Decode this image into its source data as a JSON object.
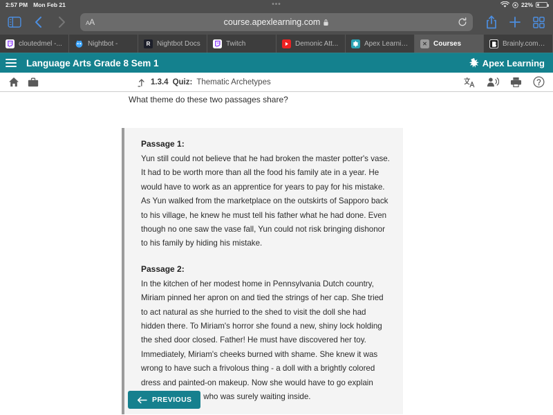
{
  "status_bar": {
    "time": "2:57 PM",
    "date": "Mon Feb 21",
    "battery_percent": "22%",
    "wifi_icon": "wifi-icon",
    "battery_icon": "battery-icon"
  },
  "browser": {
    "sidebar_icon": "sidebar-icon",
    "back_icon": "chevron-left-icon",
    "forward_icon": "chevron-right-icon",
    "text_size_label": "AA",
    "url": "course.apexlearning.com",
    "lock_icon": "lock-icon",
    "reload_icon": "reload-icon",
    "share_icon": "share-icon",
    "new_tab_icon": "plus-icon",
    "tabs_overview_icon": "grid-icon",
    "tabs": [
      {
        "label": "cloutedmel -...",
        "favicon": "twitch-icon",
        "active": false
      },
      {
        "label": "Nightbot -",
        "favicon": "nightbot-icon",
        "active": false
      },
      {
        "label": "Nightbot Docs",
        "favicon": "readme-icon",
        "active": false
      },
      {
        "label": "Twitch",
        "favicon": "twitch-icon",
        "active": false
      },
      {
        "label": "Demonic Att...",
        "favicon": "youtube-icon",
        "active": false
      },
      {
        "label": "Apex Learning",
        "favicon": "apex-icon",
        "active": false
      },
      {
        "label": "Courses",
        "favicon": "blank-icon",
        "active": true
      },
      {
        "label": "Brainly.com -...",
        "favicon": "brainly-icon",
        "active": false
      }
    ]
  },
  "app_header": {
    "menu_icon": "list-menu-icon",
    "course_title": "Language Arts Grade 8 Sem 1",
    "brand_name": "Apex Learning",
    "brand_icon": "apex-logo-icon",
    "background_color": "#14818e"
  },
  "breadcrumb": {
    "home_icon": "home-icon",
    "briefcase_icon": "briefcase-icon",
    "up_icon": "arrow-up-icon",
    "lesson_number": "1.3.4",
    "activity_type": "Quiz:",
    "activity_title": "Thematic Archetypes",
    "translate_icon": "translate-icon",
    "read_aloud_icon": "read-aloud-icon",
    "print_icon": "print-icon",
    "help_icon": "help-icon"
  },
  "main": {
    "question": "What theme do these two passages share?",
    "passages": [
      {
        "title": "Passage 1:",
        "text": "Yun still could not believe that he had broken the master potter's vase. It had to be worth more than all the food his family ate in a year. He would have to work as an apprentice for years to pay for his mistake. As Yun walked from the marketplace on the outskirts of Sapporo back to his village, he knew he must tell his father what he had done. Even though no one saw the vase fall, Yun could not risk bringing dishonor to his family by hiding his mistake."
      },
      {
        "title": "Passage 2:",
        "text": "In the kitchen of her modest home in Pennsylvania Dutch country, Miriam pinned her apron on and tied the strings of her cap. She tried to act natural as she hurried to the shed to visit the doll she had hidden there. To Miriam's horror she found a new, shiny lock holding the shed door closed. Father! He must have discovered her toy. Immediately, Miriam's cheeks burned with shame. She knew it was wrong to have such a frivolous thing - a doll with a brightly colored dress and painted-on makeup. Now she would have to go explain herself to Father, who was surely waiting inside."
      }
    ],
    "previous_button_label": "PREVIOUS",
    "previous_button_icon": "arrow-left-icon",
    "previous_button_color": "#16808e"
  }
}
